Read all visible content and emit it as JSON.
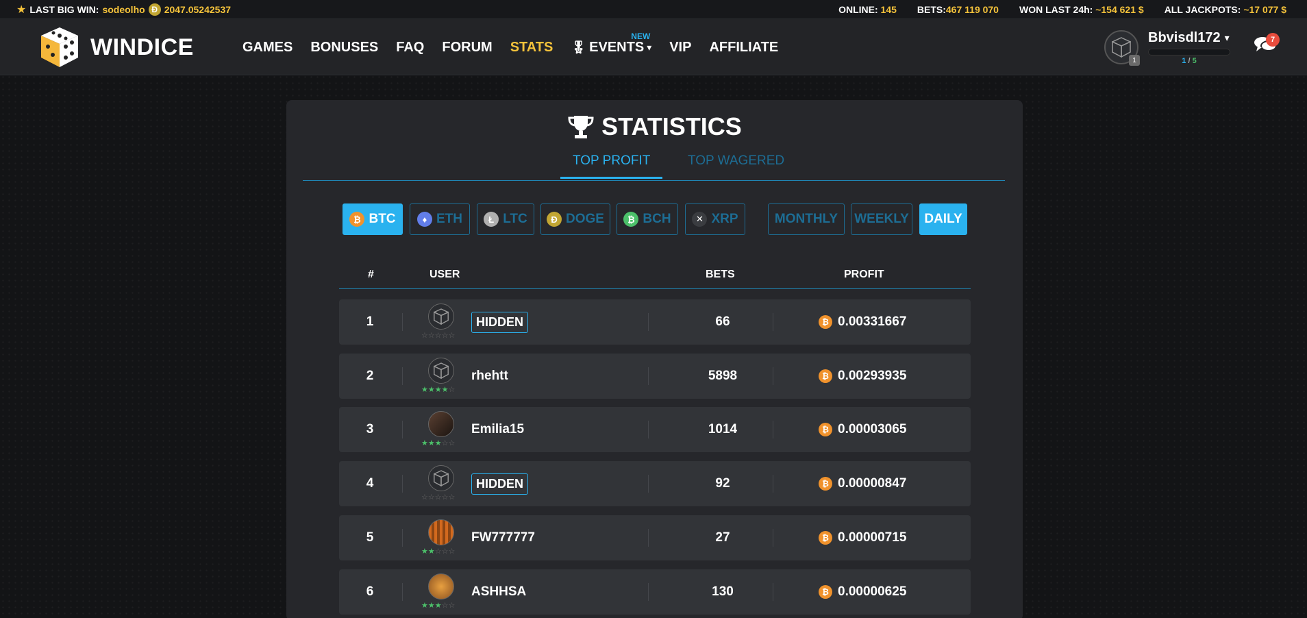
{
  "ticker": {
    "last_big_win_label": "LAST BIG WIN:",
    "last_big_win_user": "sodeolho",
    "last_big_win_amount": "2047.05242537",
    "online_label": "ONLINE:",
    "online_value": "145",
    "bets_label": "BETS:",
    "bets_value": "467 119 070",
    "won_label": "WON LAST 24h:",
    "won_value": "~154 621 $",
    "jackpots_label": "ALL JACKPOTS:",
    "jackpots_value": "~17 077 $"
  },
  "brand": "WINDICE",
  "nav": {
    "games": "GAMES",
    "bonuses": "BONUSES",
    "faq": "FAQ",
    "forum": "FORUM",
    "stats": "STATS",
    "events": "EVENTS",
    "events_badge": "NEW",
    "vip": "VIP",
    "affiliate": "AFFILIATE"
  },
  "user": {
    "name": "Bbvisdl172",
    "level": "1",
    "xp_current": "1",
    "xp_sep": "/",
    "xp_total": "5",
    "chat_count": "7"
  },
  "stats": {
    "title": "STATISTICS",
    "tab_profit": "TOP PROFIT",
    "tab_wagered": "TOP WAGERED",
    "coins": [
      "BTC",
      "ETH",
      "LTC",
      "DOGE",
      "BCH",
      "XRP"
    ],
    "periods": [
      "MONTHLY",
      "WEEKLY",
      "DAILY"
    ],
    "columns": {
      "rank": "#",
      "user": "USER",
      "bets": "BETS",
      "profit": "PROFIT"
    },
    "rows": [
      {
        "rank": "1",
        "user": "HIDDEN",
        "bets": "66",
        "profit": "0.00331667",
        "stars": 0
      },
      {
        "rank": "2",
        "user": "rhehtt",
        "bets": "5898",
        "profit": "0.00293935",
        "stars": 4
      },
      {
        "rank": "3",
        "user": "Emilia15",
        "bets": "1014",
        "profit": "0.00003065",
        "stars": 3
      },
      {
        "rank": "4",
        "user": "HIDDEN",
        "bets": "92",
        "profit": "0.00000847",
        "stars": 0
      },
      {
        "rank": "5",
        "user": "FW777777",
        "bets": "27",
        "profit": "0.00000715",
        "stars": 2
      },
      {
        "rank": "6",
        "user": "ASHHSA",
        "bets": "130",
        "profit": "0.00000625",
        "stars": 3
      }
    ]
  },
  "colors": {
    "accent": "#2ab2ef",
    "gold": "#f5c33b",
    "btc": "#f0922c",
    "star_on": "#4cc06a"
  }
}
